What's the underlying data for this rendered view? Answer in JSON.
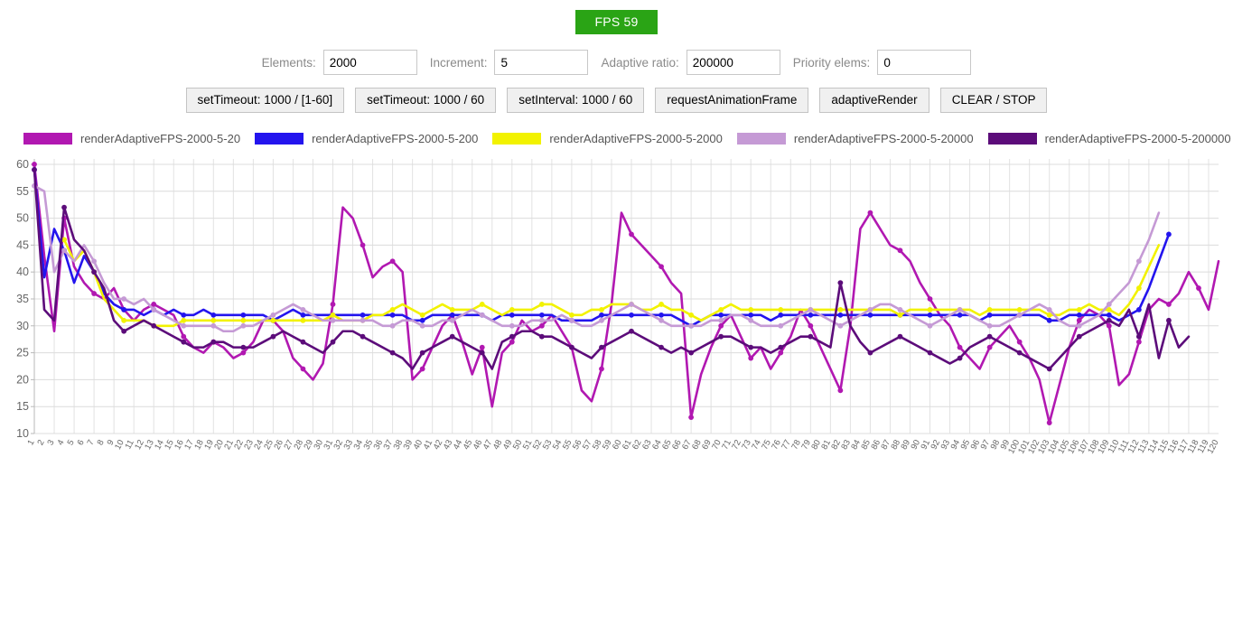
{
  "fps": {
    "label": "FPS 59",
    "color": "#2aa415"
  },
  "controls": {
    "fields": [
      {
        "name": "elements",
        "label": "Elements:",
        "value": "2000",
        "placeholder": ""
      },
      {
        "name": "increment",
        "label": "Increment:",
        "value": "5",
        "placeholder": ""
      },
      {
        "name": "ratio",
        "label": "Adaptive ratio:",
        "value": "200000",
        "placeholder": ""
      },
      {
        "name": "priority",
        "label": "Priority elems:",
        "value": "0",
        "placeholder": ""
      }
    ],
    "buttons": [
      {
        "name": "set-timeout-range",
        "label": "setTimeout: 1000 / [1-60]"
      },
      {
        "name": "set-timeout-60",
        "label": "setTimeout: 1000 / 60"
      },
      {
        "name": "set-interval-60",
        "label": "setInterval: 1000 / 60"
      },
      {
        "name": "request-animation-frame",
        "label": "requestAnimationFrame"
      },
      {
        "name": "adaptive-render",
        "label": "adaptiveRender"
      },
      {
        "name": "clear-stop",
        "label": "CLEAR / STOP"
      }
    ]
  },
  "chart_data": {
    "type": "line",
    "title": "",
    "xlabel": "",
    "ylabel": "",
    "grid": true,
    "legend_position": "top",
    "ylim": [
      10,
      61
    ],
    "yticks": [
      10,
      15,
      20,
      25,
      30,
      35,
      40,
      45,
      50,
      55,
      60
    ],
    "xlim": [
      1,
      120
    ],
    "x": [
      1,
      2,
      3,
      4,
      5,
      6,
      7,
      8,
      9,
      10,
      11,
      12,
      13,
      14,
      15,
      16,
      17,
      18,
      19,
      20,
      21,
      22,
      23,
      24,
      25,
      26,
      27,
      28,
      29,
      30,
      31,
      32,
      33,
      34,
      35,
      36,
      37,
      38,
      39,
      40,
      41,
      42,
      43,
      44,
      45,
      46,
      47,
      48,
      49,
      50,
      51,
      52,
      53,
      54,
      55,
      56,
      57,
      58,
      59,
      60,
      61,
      62,
      63,
      64,
      65,
      66,
      67,
      68,
      69,
      70,
      71,
      72,
      73,
      74,
      75,
      76,
      77,
      78,
      79,
      80,
      81,
      82,
      83,
      84,
      85,
      86,
      87,
      88,
      89,
      90,
      91,
      92,
      93,
      94,
      95,
      96,
      97,
      98,
      99,
      100,
      101,
      102,
      103,
      104,
      105,
      106,
      107,
      108,
      109,
      110,
      111,
      112,
      113,
      114,
      115,
      116,
      117,
      118,
      119,
      120
    ],
    "series": [
      {
        "name": "renderAdaptiveFPS-2000-5-20",
        "color": "#b118b1",
        "values": [
          60,
          43,
          29,
          50,
          41,
          38,
          36,
          35,
          37,
          33,
          31,
          33,
          34,
          33,
          32,
          28,
          26,
          25,
          27,
          26,
          24,
          25,
          27,
          31,
          31,
          29,
          24,
          22,
          20,
          23,
          34,
          52,
          50,
          45,
          39,
          41,
          42,
          40,
          20,
          22,
          26,
          30,
          32,
          27,
          21,
          26,
          15,
          25,
          27,
          31,
          29,
          30,
          32,
          29,
          26,
          18,
          16,
          22,
          34,
          51,
          47,
          45,
          43,
          41,
          38,
          36,
          13,
          21,
          26,
          30,
          32,
          28,
          24,
          26,
          22,
          25,
          28,
          33,
          30,
          26,
          22,
          18,
          30,
          48,
          51,
          48,
          45,
          44,
          42,
          38,
          35,
          32,
          30,
          26,
          24,
          22,
          26,
          28,
          30,
          27,
          24,
          20,
          12,
          19,
          26,
          31,
          33,
          32,
          30,
          19,
          21,
          27,
          33,
          35,
          34,
          36,
          40,
          37,
          33,
          42
        ]
      },
      {
        "name": "renderAdaptiveFPS-2000-5-200",
        "color": "#2314ee",
        "values": [
          59,
          39,
          48,
          44,
          38,
          43,
          40,
          36,
          34,
          33,
          33,
          32,
          33,
          32,
          33,
          32,
          32,
          33,
          32,
          32,
          32,
          32,
          32,
          32,
          31,
          32,
          33,
          32,
          32,
          32,
          32,
          32,
          32,
          32,
          32,
          32,
          32,
          32,
          31,
          31,
          32,
          32,
          32,
          32,
          32,
          32,
          31,
          32,
          32,
          32,
          32,
          32,
          32,
          31,
          31,
          31,
          31,
          32,
          32,
          32,
          32,
          32,
          32,
          32,
          32,
          31,
          30,
          31,
          32,
          32,
          32,
          32,
          32,
          32,
          31,
          32,
          32,
          32,
          32,
          32,
          32,
          32,
          32,
          32,
          32,
          32,
          32,
          32,
          32,
          32,
          32,
          32,
          32,
          32,
          32,
          31,
          32,
          32,
          32,
          32,
          32,
          32,
          31,
          31,
          32,
          32,
          32,
          32,
          32,
          31,
          32,
          33,
          37,
          42,
          47,
          null,
          null,
          null,
          null,
          null
        ]
      },
      {
        "name": "renderAdaptiveFPS-2000-5-2000",
        "color": "#f2f200",
        "values": [
          null,
          null,
          null,
          46,
          42,
          44,
          40,
          35,
          33,
          31,
          31,
          31,
          30,
          30,
          30,
          31,
          31,
          31,
          31,
          31,
          31,
          31,
          31,
          31,
          31,
          31,
          31,
          31,
          31,
          31,
          32,
          31,
          31,
          31,
          32,
          32,
          33,
          34,
          33,
          32,
          33,
          34,
          33,
          33,
          33,
          34,
          33,
          32,
          33,
          33,
          33,
          34,
          34,
          33,
          32,
          32,
          33,
          33,
          34,
          34,
          34,
          33,
          33,
          34,
          33,
          33,
          32,
          31,
          32,
          33,
          34,
          33,
          33,
          33,
          33,
          33,
          33,
          33,
          33,
          33,
          33,
          33,
          33,
          33,
          33,
          33,
          33,
          32,
          33,
          33,
          33,
          33,
          33,
          33,
          33,
          32,
          33,
          33,
          33,
          33,
          33,
          33,
          32,
          32,
          33,
          33,
          34,
          33,
          33,
          32,
          34,
          37,
          41,
          45,
          null,
          null,
          null,
          null,
          null,
          null
        ]
      },
      {
        "name": "renderAdaptiveFPS-2000-5-20000",
        "color": "#c59ad5",
        "values": [
          56,
          55,
          40,
          44,
          42,
          45,
          42,
          38,
          35,
          35,
          34,
          35,
          33,
          32,
          31,
          30,
          30,
          30,
          30,
          29,
          29,
          30,
          30,
          31,
          32,
          33,
          34,
          33,
          32,
          31,
          31,
          31,
          31,
          31,
          31,
          30,
          30,
          31,
          31,
          30,
          30,
          31,
          31,
          32,
          33,
          32,
          31,
          30,
          30,
          30,
          31,
          31,
          31,
          32,
          31,
          30,
          30,
          31,
          32,
          33,
          34,
          33,
          32,
          31,
          30,
          30,
          30,
          30,
          31,
          31,
          32,
          32,
          31,
          30,
          30,
          30,
          31,
          32,
          33,
          32,
          31,
          30,
          31,
          32,
          33,
          34,
          34,
          33,
          32,
          31,
          30,
          31,
          32,
          33,
          32,
          31,
          30,
          30,
          31,
          32,
          33,
          34,
          33,
          31,
          30,
          30,
          31,
          32,
          34,
          36,
          38,
          42,
          46,
          51,
          null,
          null,
          null,
          null,
          null,
          null
        ]
      },
      {
        "name": "renderAdaptiveFPS-2000-5-200000",
        "color": "#5c0c7a",
        "values": [
          59,
          33,
          31,
          52,
          46,
          44,
          40,
          37,
          31,
          29,
          30,
          31,
          30,
          29,
          28,
          27,
          26,
          26,
          27,
          27,
          26,
          26,
          26,
          27,
          28,
          29,
          28,
          27,
          26,
          25,
          27,
          29,
          29,
          28,
          27,
          26,
          25,
          24,
          22,
          25,
          26,
          27,
          28,
          27,
          26,
          25,
          22,
          27,
          28,
          29,
          29,
          28,
          28,
          27,
          26,
          25,
          24,
          26,
          27,
          28,
          29,
          28,
          27,
          26,
          25,
          26,
          25,
          26,
          27,
          28,
          28,
          27,
          26,
          26,
          25,
          26,
          27,
          28,
          28,
          27,
          26,
          38,
          30,
          27,
          25,
          26,
          27,
          28,
          27,
          26,
          25,
          24,
          23,
          24,
          26,
          27,
          28,
          27,
          26,
          25,
          24,
          23,
          22,
          24,
          26,
          28,
          29,
          30,
          31,
          30,
          33,
          28,
          34,
          24,
          31,
          26,
          28,
          null,
          null,
          null
        ]
      }
    ]
  }
}
